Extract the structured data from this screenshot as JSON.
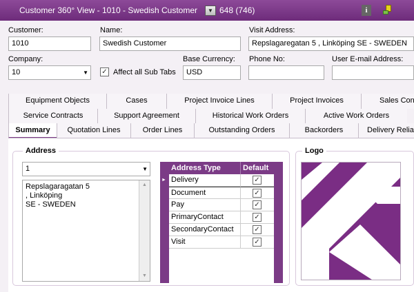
{
  "window": {
    "title": "Customer 360° View - 1010 - Swedish Customer",
    "record_count": "648 (746)"
  },
  "form": {
    "customer_label": "Customer:",
    "customer_value": "1010",
    "name_label": "Name:",
    "name_value": "Swedish Customer",
    "visit_address_label": "Visit Address:",
    "visit_address_value": "Repslagaregatan 5 , Linköping SE - SWEDEN",
    "company_label": "Company:",
    "company_value": "10",
    "affect_all_label": "Affect all Sub Tabs",
    "affect_all_checked": true,
    "base_currency_label": "Base Currency:",
    "base_currency_value": "USD",
    "phone_label": "Phone No:",
    "phone_value": "",
    "email_label": "User E-mail Address:",
    "email_value": ""
  },
  "tabs": {
    "row1": [
      "Equipment Objects",
      "Cases",
      "Project Invoice Lines",
      "Project Invoices",
      "Sales Con"
    ],
    "row2": [
      "Service Contracts",
      "Support Agreement",
      "Historical Work Orders",
      "Active Work Orders"
    ],
    "row3": [
      "Summary",
      "Quotation Lines",
      "Order Lines",
      "Outstanding Orders",
      "Backorders",
      "Delivery Reliab"
    ],
    "active": "Summary"
  },
  "address": {
    "group_title": "Address",
    "selector_value": "1",
    "memo_lines": [
      "Repslagaragatan 5",
      ", Linköping",
      "SE - SWEDEN"
    ],
    "grid": {
      "col_type": "Address Type",
      "col_default": "Default",
      "rows": [
        {
          "type": "Delivery",
          "default": true
        },
        {
          "type": "Document",
          "default": true
        },
        {
          "type": "Pay",
          "default": true
        },
        {
          "type": "PrimaryContact",
          "default": true
        },
        {
          "type": "SecondaryContact",
          "default": true
        },
        {
          "type": "Visit",
          "default": true
        }
      ]
    }
  },
  "logo": {
    "group_title": "Logo"
  },
  "colors": {
    "accent": "#7b3b86",
    "title_bar": "#6d2b7a"
  }
}
